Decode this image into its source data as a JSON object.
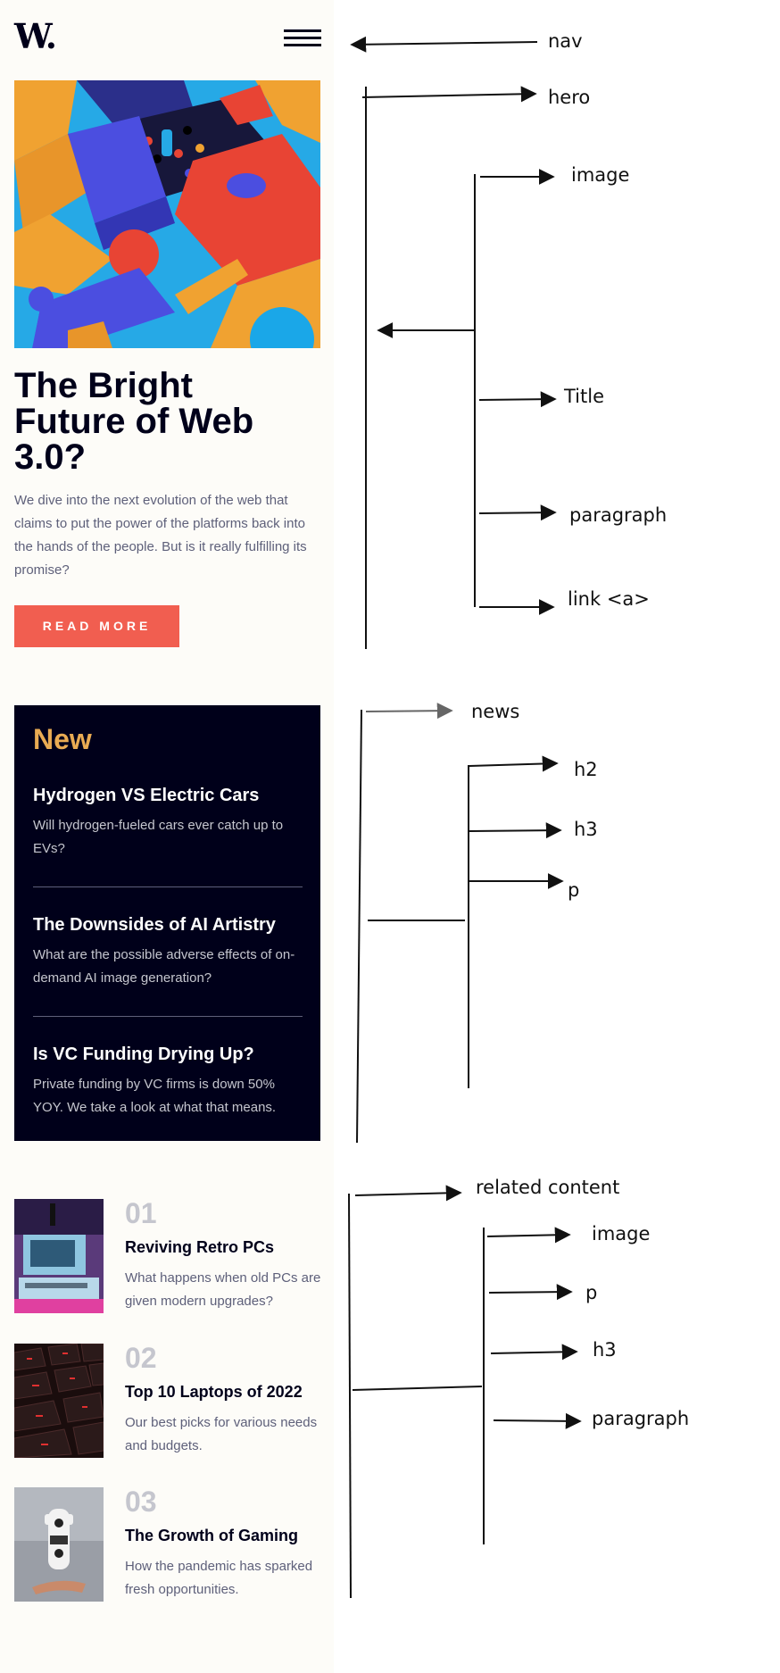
{
  "mock_page": {
    "logo": "W.",
    "icons": {
      "menu": "hamburger-icon"
    },
    "hero": {
      "title": "The Bright Future of Web 3.0?",
      "text": "We dive into the next evolution of the web that claims to put the power of the platforms back into the hands of the people. But is it really fulfilling its promise?",
      "button": "READ MORE"
    },
    "news": {
      "heading": "New",
      "items": [
        {
          "title": "Hydrogen VS Electric Cars",
          "text": "Will hydrogen-fueled cars ever catch up to EVs?"
        },
        {
          "title": "The Downsides of AI Artistry",
          "text": "What are the possible adverse effects of on-demand AI image generation?"
        },
        {
          "title": "Is VC Funding Drying Up?",
          "text": "Private funding by VC firms is down 50% YOY. We take a look at what that means."
        }
      ]
    },
    "related": [
      {
        "num": "01",
        "title": "Reviving Retro PCs",
        "text": "What happens when old PCs are given modern upgrades?"
      },
      {
        "num": "02",
        "title": "Top 10 Laptops of 2022",
        "text": "Our best picks for various needs and budgets."
      },
      {
        "num": "03",
        "title": "The Growth of Gaming",
        "text": "How the pandemic has sparked fresh opportunities."
      }
    ],
    "colors": {
      "background": "#fdfcf8",
      "dark": "#00001a",
      "accent_red": "#f15e50",
      "accent_orange": "#e9ab53",
      "muted": "#5e607a",
      "light_grey": "#c5c6ce"
    }
  },
  "annotations": {
    "nav": "nav",
    "hero": "hero",
    "hero_image": "image",
    "hero_title": "Title",
    "hero_paragraph": "paragraph",
    "hero_link": "link <a>",
    "news": "news",
    "news_h2": "h2",
    "news_h3": "h3",
    "news_p": "p",
    "related": "related content",
    "related_image": "image",
    "related_p": "p",
    "related_h3": "h3",
    "related_paragraph": "paragraph"
  }
}
